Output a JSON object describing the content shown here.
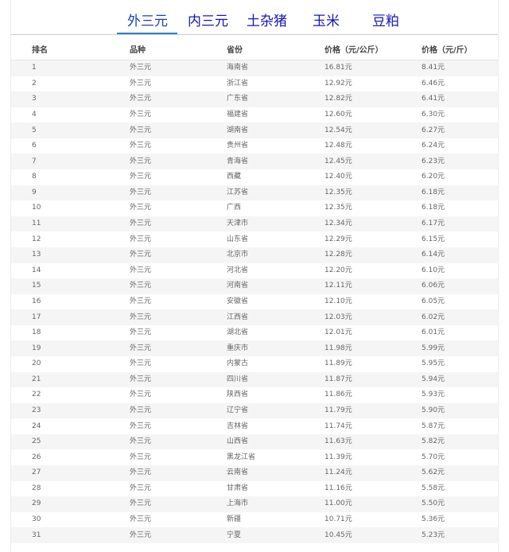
{
  "tabs": [
    {
      "label": "外三元"
    },
    {
      "label": "内三元"
    },
    {
      "label": "土杂猪"
    },
    {
      "label": "玉米"
    },
    {
      "label": "豆粕"
    }
  ],
  "table": {
    "headers": [
      "排名",
      "品种",
      "省份",
      "价格（元/公斤）",
      "价格（元/斤）"
    ],
    "rows": [
      [
        "1",
        "外三元",
        "海南省",
        "16.81元",
        "8.41元"
      ],
      [
        "2",
        "外三元",
        "浙江省",
        "12.92元",
        "6.46元"
      ],
      [
        "3",
        "外三元",
        "广东省",
        "12.82元",
        "6.41元"
      ],
      [
        "4",
        "外三元",
        "福建省",
        "12.60元",
        "6.30元"
      ],
      [
        "5",
        "外三元",
        "湖南省",
        "12.54元",
        "6.27元"
      ],
      [
        "6",
        "外三元",
        "贵州省",
        "12.48元",
        "6.24元"
      ],
      [
        "7",
        "外三元",
        "青海省",
        "12.45元",
        "6.23元"
      ],
      [
        "8",
        "外三元",
        "西藏",
        "12.40元",
        "6.20元"
      ],
      [
        "9",
        "外三元",
        "江苏省",
        "12.35元",
        "6.18元"
      ],
      [
        "10",
        "外三元",
        "广西",
        "12.35元",
        "6.18元"
      ],
      [
        "11",
        "外三元",
        "天津市",
        "12.34元",
        "6.17元"
      ],
      [
        "12",
        "外三元",
        "山东省",
        "12.29元",
        "6.15元"
      ],
      [
        "13",
        "外三元",
        "北京市",
        "12.28元",
        "6.14元"
      ],
      [
        "14",
        "外三元",
        "河北省",
        "12.20元",
        "6.10元"
      ],
      [
        "15",
        "外三元",
        "河南省",
        "12.11元",
        "6.06元"
      ],
      [
        "16",
        "外三元",
        "安徽省",
        "12.10元",
        "6.05元"
      ],
      [
        "17",
        "外三元",
        "江西省",
        "12.03元",
        "6.02元"
      ],
      [
        "18",
        "外三元",
        "湖北省",
        "12.01元",
        "6.01元"
      ],
      [
        "19",
        "外三元",
        "重庆市",
        "11.98元",
        "5.99元"
      ],
      [
        "20",
        "外三元",
        "内蒙古",
        "11.89元",
        "5.95元"
      ],
      [
        "21",
        "外三元",
        "四川省",
        "11.87元",
        "5.94元"
      ],
      [
        "22",
        "外三元",
        "陕西省",
        "11.86元",
        "5.93元"
      ],
      [
        "23",
        "外三元",
        "辽宁省",
        "11.79元",
        "5.90元"
      ],
      [
        "24",
        "外三元",
        "吉林省",
        "11.74元",
        "5.87元"
      ],
      [
        "25",
        "外三元",
        "山西省",
        "11.63元",
        "5.82元"
      ],
      [
        "26",
        "外三元",
        "黑龙江省",
        "11.39元",
        "5.70元"
      ],
      [
        "27",
        "外三元",
        "云南省",
        "11.24元",
        "5.62元"
      ],
      [
        "28",
        "外三元",
        "甘肃省",
        "11.16元",
        "5.58元"
      ],
      [
        "29",
        "外三元",
        "上海市",
        "11.00元",
        "5.50元"
      ],
      [
        "30",
        "外三元",
        "新疆",
        "10.71元",
        "5.36元"
      ],
      [
        "31",
        "外三元",
        "宁夏",
        "10.45元",
        "5.23元"
      ]
    ]
  }
}
